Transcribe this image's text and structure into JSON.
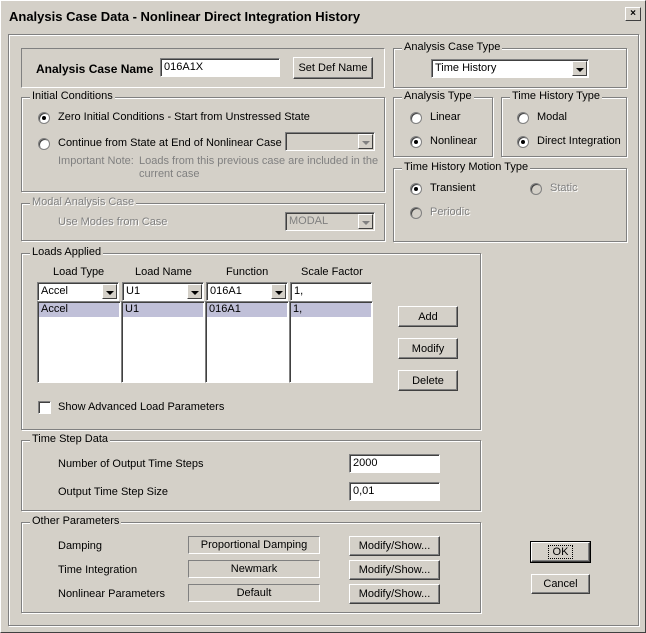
{
  "window": {
    "title": "Analysis Case Data - Nonlinear Direct Integration History",
    "close_glyph": "×"
  },
  "analysis_case_name": {
    "label": "Analysis Case Name",
    "value": "016A1X",
    "set_def_button": "Set Def Name"
  },
  "initial_conditions": {
    "title": "Initial Conditions",
    "option_zero": "Zero Initial Conditions - Start from Unstressed State",
    "option_continue": "Continue from State at End of Nonlinear Case",
    "note_label": "Important Note:",
    "note_line1": "Loads from this previous case are included in the",
    "note_line2": "current case"
  },
  "modal_analysis_case": {
    "title": "Modal Analysis Case",
    "label": "Use Modes from Case",
    "value": "MODAL"
  },
  "loads_applied": {
    "title": "Loads Applied",
    "headers": [
      "Load Type",
      "Load Name",
      "Function",
      "Scale Factor"
    ],
    "input": {
      "load_type": "Accel",
      "load_name": "U1",
      "function": "016A1",
      "scale_factor": "1,"
    },
    "rows": [
      {
        "load_type": "Accel",
        "load_name": "U1",
        "function": "016A1",
        "scale_factor": "1,"
      }
    ],
    "add_button": "Add",
    "modify_button": "Modify",
    "delete_button": "Delete",
    "show_advanced": "Show Advanced Load Parameters"
  },
  "time_step_data": {
    "title": "Time Step Data",
    "num_steps_label": "Number of Output Time Steps",
    "num_steps_value": "2000",
    "step_size_label": "Output Time Step Size",
    "step_size_value": "0,01"
  },
  "other_parameters": {
    "title": "Other Parameters",
    "damping_label": "Damping",
    "damping_value": "Proportional Damping",
    "time_integration_label": "Time Integration",
    "time_integration_value": "Newmark",
    "nonlinear_label": "Nonlinear Parameters",
    "nonlinear_value": "Default",
    "modify_show": "Modify/Show..."
  },
  "analysis_case_type": {
    "title": "Analysis Case Type",
    "value": "Time History"
  },
  "analysis_type": {
    "title": "Analysis Type",
    "linear": "Linear",
    "nonlinear": "Nonlinear"
  },
  "time_history_type": {
    "title": "Time History Type",
    "modal": "Modal",
    "direct": "Direct Integration"
  },
  "motion_type": {
    "title": "Time History Motion Type",
    "transient": "Transient",
    "static": "Static",
    "periodic": "Periodic"
  },
  "ok_button": "OK",
  "cancel_button": "Cancel"
}
